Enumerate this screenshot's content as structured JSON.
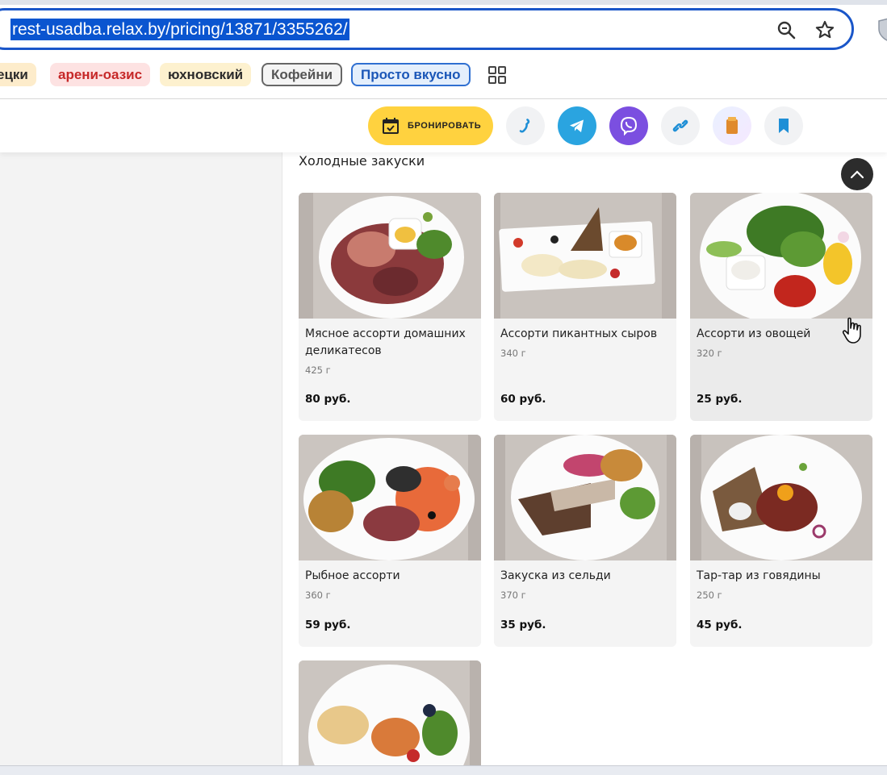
{
  "browser": {
    "url": "rest-usadba.relax.by/pricing/13871/3355262/",
    "zoom_icon": "zoom-icon",
    "star_icon": "star-icon",
    "bookmarks": [
      {
        "label": "ецки",
        "color": "#fdeccb"
      },
      {
        "label": "арени-оазис",
        "color": "#fde2e2"
      },
      {
        "label": "юхновский",
        "color": "#fdf1cf"
      },
      {
        "label": "Кофейни",
        "color": "#f4f4f4"
      },
      {
        "label": "Просто вкусно",
        "color": "#e4effc"
      }
    ]
  },
  "header": {
    "book_label": "БРОНИРОВАТЬ",
    "accent": "#ffd23f",
    "buttons": [
      "phone-icon",
      "telegram-icon",
      "viber-icon",
      "link-icon",
      "app-icon",
      "bookmark-icon"
    ]
  },
  "menu": {
    "section_title": "Холодные закуски",
    "items": [
      {
        "name": "Мясное ассорти домашних деликатесов",
        "weight": "425 г",
        "price": "80 руб."
      },
      {
        "name": "Ассорти пикантных сыров",
        "weight": "340 г",
        "price": "60 руб."
      },
      {
        "name": "Ассорти из овощей",
        "weight": "320 г",
        "price": "25 руб."
      },
      {
        "name": "Рыбное ассорти",
        "weight": "360 г",
        "price": "59 руб."
      },
      {
        "name": "Закуска из сельди",
        "weight": "370 г",
        "price": "35 руб."
      },
      {
        "name": "Тар-тар из говядины",
        "weight": "250 г",
        "price": "45 руб."
      }
    ]
  }
}
